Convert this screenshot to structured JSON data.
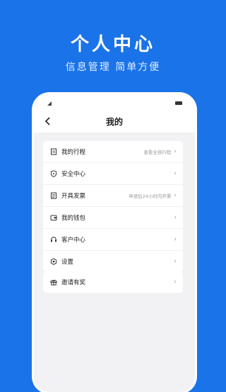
{
  "promo": {
    "title": "个人中心",
    "subtitle": "信息管理 简单方便"
  },
  "nav": {
    "title": "我的",
    "back_icon": "chevron-left-icon"
  },
  "menu": [
    {
      "label": "我的行程",
      "hint": "查看全部行程",
      "icon": "trip-icon"
    },
    {
      "label": "安全中心",
      "hint": "",
      "icon": "shield-icon"
    },
    {
      "label": "开具发票",
      "hint": "申请后24小时内开票",
      "icon": "invoice-icon"
    },
    {
      "label": "我的钱包",
      "hint": "",
      "icon": "wallet-icon"
    },
    {
      "label": "客户中心",
      "hint": "",
      "icon": "headset-icon"
    },
    {
      "label": "设置",
      "hint": "",
      "icon": "settings-icon"
    }
  ],
  "invite": {
    "label": "邀请有奖",
    "icon": "gift-icon"
  },
  "chevron": "›",
  "colors": {
    "background": "#1a73e8",
    "card": "#ffffff",
    "screen": "#f2f2f4"
  }
}
